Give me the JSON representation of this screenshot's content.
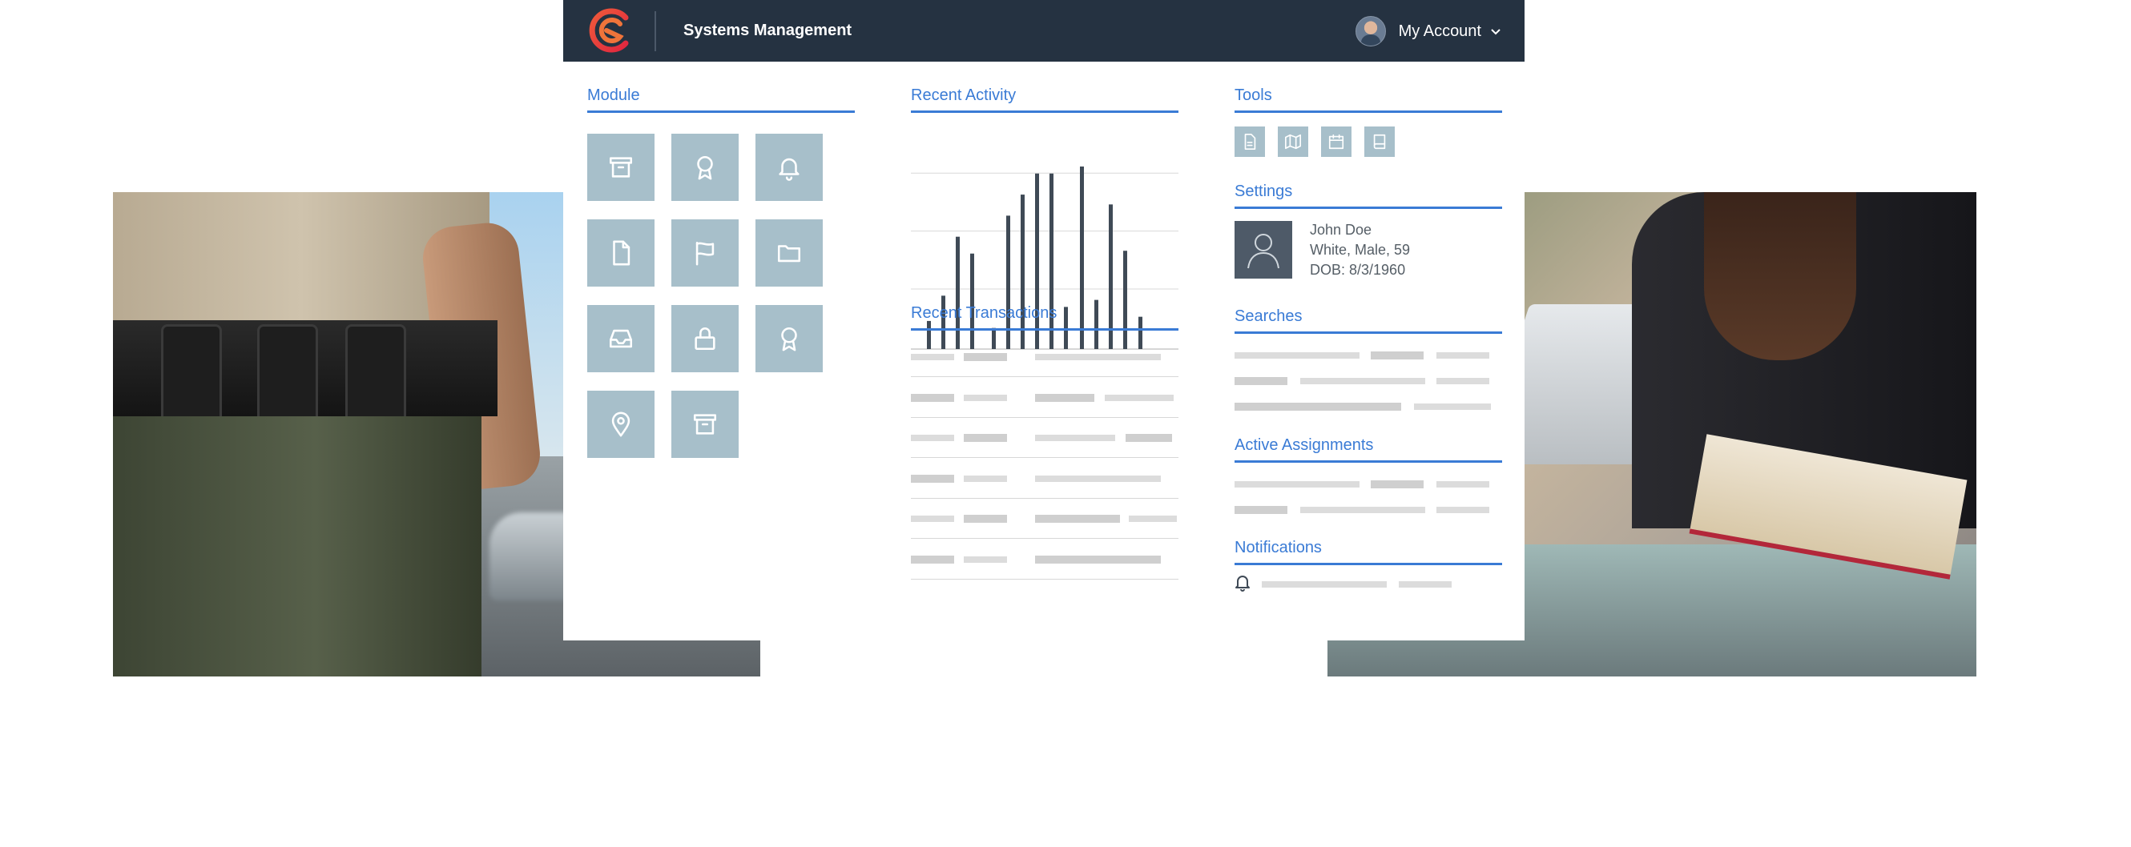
{
  "header": {
    "app_title": "Systems  Management",
    "account_label": "My  Account"
  },
  "sections": {
    "module": "Module",
    "recent_activity": "Recent Activity",
    "recent_transactions": "Recent Transactions",
    "tools": "Tools",
    "settings": "Settings",
    "searches": "Searches",
    "active_assignments": "Active Assignments",
    "notifications": "Notifications"
  },
  "modules": [
    {
      "icon": "archive-icon"
    },
    {
      "icon": "award-icon"
    },
    {
      "icon": "bell-icon"
    },
    {
      "icon": "file-icon"
    },
    {
      "icon": "flag-icon"
    },
    {
      "icon": "folder-icon"
    },
    {
      "icon": "inbox-icon"
    },
    {
      "icon": "lock-icon"
    },
    {
      "icon": "award-icon"
    },
    {
      "icon": "map-pin-icon"
    },
    {
      "icon": "archive-icon"
    }
  ],
  "tools": [
    {
      "icon": "file-text-icon"
    },
    {
      "icon": "map-icon"
    },
    {
      "icon": "calendar-icon"
    },
    {
      "icon": "book-icon"
    }
  ],
  "profile": {
    "name": "John Doe",
    "details": "White, Male, 59",
    "dob": "DOB: 8/3/1960"
  },
  "chart_data": {
    "type": "bar",
    "values": [
      2,
      3.8,
      8,
      6.8,
      1.5,
      9.5,
      11,
      12.5,
      12.5,
      3,
      13,
      3.5,
      10.3,
      7,
      2.3
    ],
    "ylim": [
      0,
      13
    ],
    "grid": true
  },
  "colors": {
    "accent": "#3a7bd5",
    "topbar": "#253241",
    "tile": "#a7bfca",
    "bar": "#3f4a56"
  }
}
